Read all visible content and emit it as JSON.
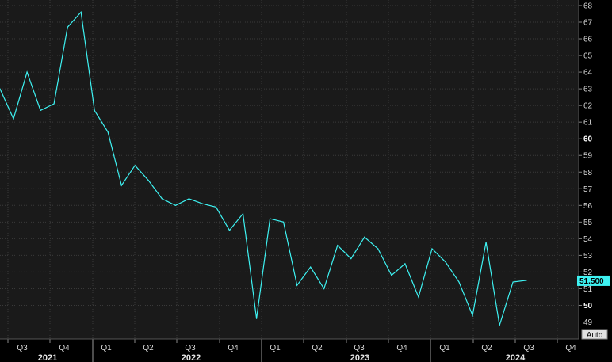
{
  "chart_data": {
    "type": "line",
    "title": "",
    "xlabel": "",
    "ylabel": "",
    "ylim": [
      48,
      68
    ],
    "y_ticks": [
      49,
      50,
      51,
      52,
      53,
      54,
      55,
      56,
      57,
      58,
      59,
      60,
      61,
      62,
      63,
      64,
      65,
      66,
      67,
      68
    ],
    "y_ticks_bold": [
      50,
      60
    ],
    "x_quarter_labels": [
      "Q3",
      "Q4",
      "Q1",
      "Q2",
      "Q3",
      "Q4",
      "Q1",
      "Q2",
      "Q3",
      "Q4",
      "Q1",
      "Q2",
      "Q3",
      "Q4"
    ],
    "x_year_labels": [
      "2021",
      "2022",
      "2023",
      "2024"
    ],
    "last_value_label": "51.500",
    "scale_button_label": "Auto",
    "grid": true,
    "colors": {
      "background": "#1a1a1a",
      "line": "#3ef2f2",
      "grid": "#3a3a3a",
      "axis": "#000000",
      "badge": "#3ef2f2"
    },
    "series": [
      {
        "values": [
          63.0,
          61.2,
          64.0,
          61.7,
          62.1,
          66.7,
          67.6,
          61.7,
          60.4,
          57.2,
          58.4,
          57.5,
          56.4,
          56.0,
          56.4,
          56.1,
          55.9,
          54.5,
          55.5,
          49.2,
          55.2,
          55.0,
          51.2,
          52.3,
          51.0,
          53.6,
          52.8,
          54.1,
          53.4,
          51.8,
          52.5,
          50.5,
          53.4,
          52.6,
          51.4,
          49.4,
          53.8,
          48.8,
          51.4,
          51.5
        ]
      }
    ]
  }
}
